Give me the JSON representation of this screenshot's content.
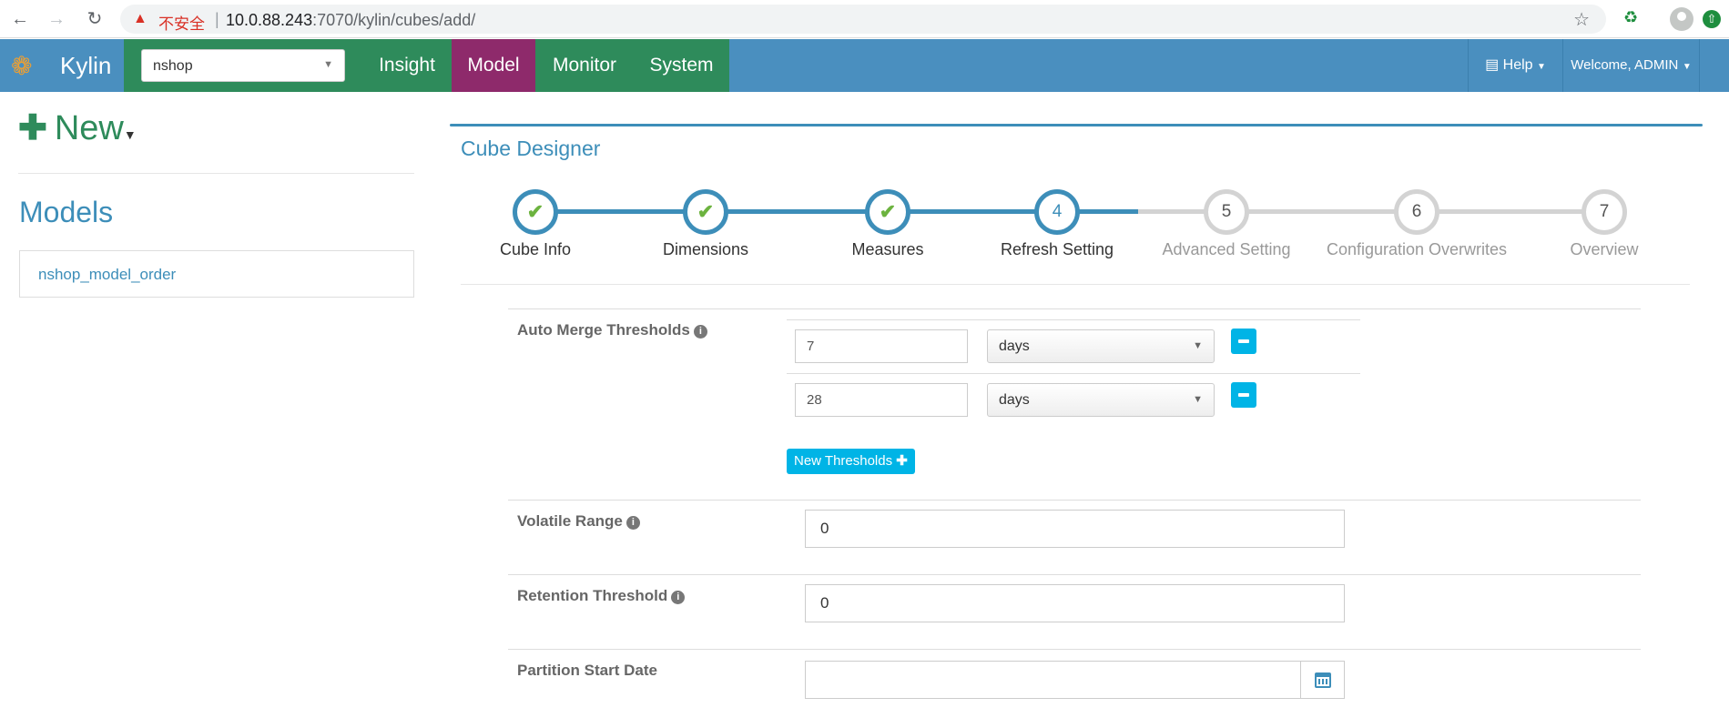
{
  "browser": {
    "warning_text": "不安全",
    "url_host": "10.0.88.243",
    "url_path": ":7070/kylin/cubes/add/"
  },
  "navbar": {
    "brand": "Kylin",
    "project": "nshop",
    "tabs": [
      "Insight",
      "Model",
      "Monitor",
      "System"
    ],
    "active_tab": "Model",
    "help_label": "Help",
    "welcome_label": "Welcome, ADMIN",
    "colors": {
      "navbar": "#4a8fbf",
      "tab_green": "#2e8b5b",
      "tab_active": "#8e2a6b"
    }
  },
  "sidebar": {
    "new_label": "New",
    "models_title": "Models",
    "models": [
      "nshop_model_order"
    ]
  },
  "designer": {
    "title": "Cube Designer",
    "steps": [
      {
        "number": "1",
        "label": "Cube Info",
        "state": "done"
      },
      {
        "number": "2",
        "label": "Dimensions",
        "state": "done"
      },
      {
        "number": "3",
        "label": "Measures",
        "state": "done"
      },
      {
        "number": "4",
        "label": "Refresh Setting",
        "state": "current"
      },
      {
        "number": "5",
        "label": "Advanced Setting",
        "state": "todo"
      },
      {
        "number": "6",
        "label": "Configuration Overwrites",
        "state": "todo"
      },
      {
        "number": "7",
        "label": "Overview",
        "state": "todo"
      }
    ]
  },
  "form": {
    "auto_merge_label": "Auto Merge Thresholds",
    "thresholds": [
      {
        "value": "7",
        "unit": "days"
      },
      {
        "value": "28",
        "unit": "days"
      }
    ],
    "new_thresholds_label": "New Thresholds",
    "volatile_label": "Volatile Range",
    "volatile_value": "0",
    "retention_label": "Retention Threshold",
    "retention_value": "0",
    "partition_label": "Partition Start Date",
    "partition_value": ""
  }
}
